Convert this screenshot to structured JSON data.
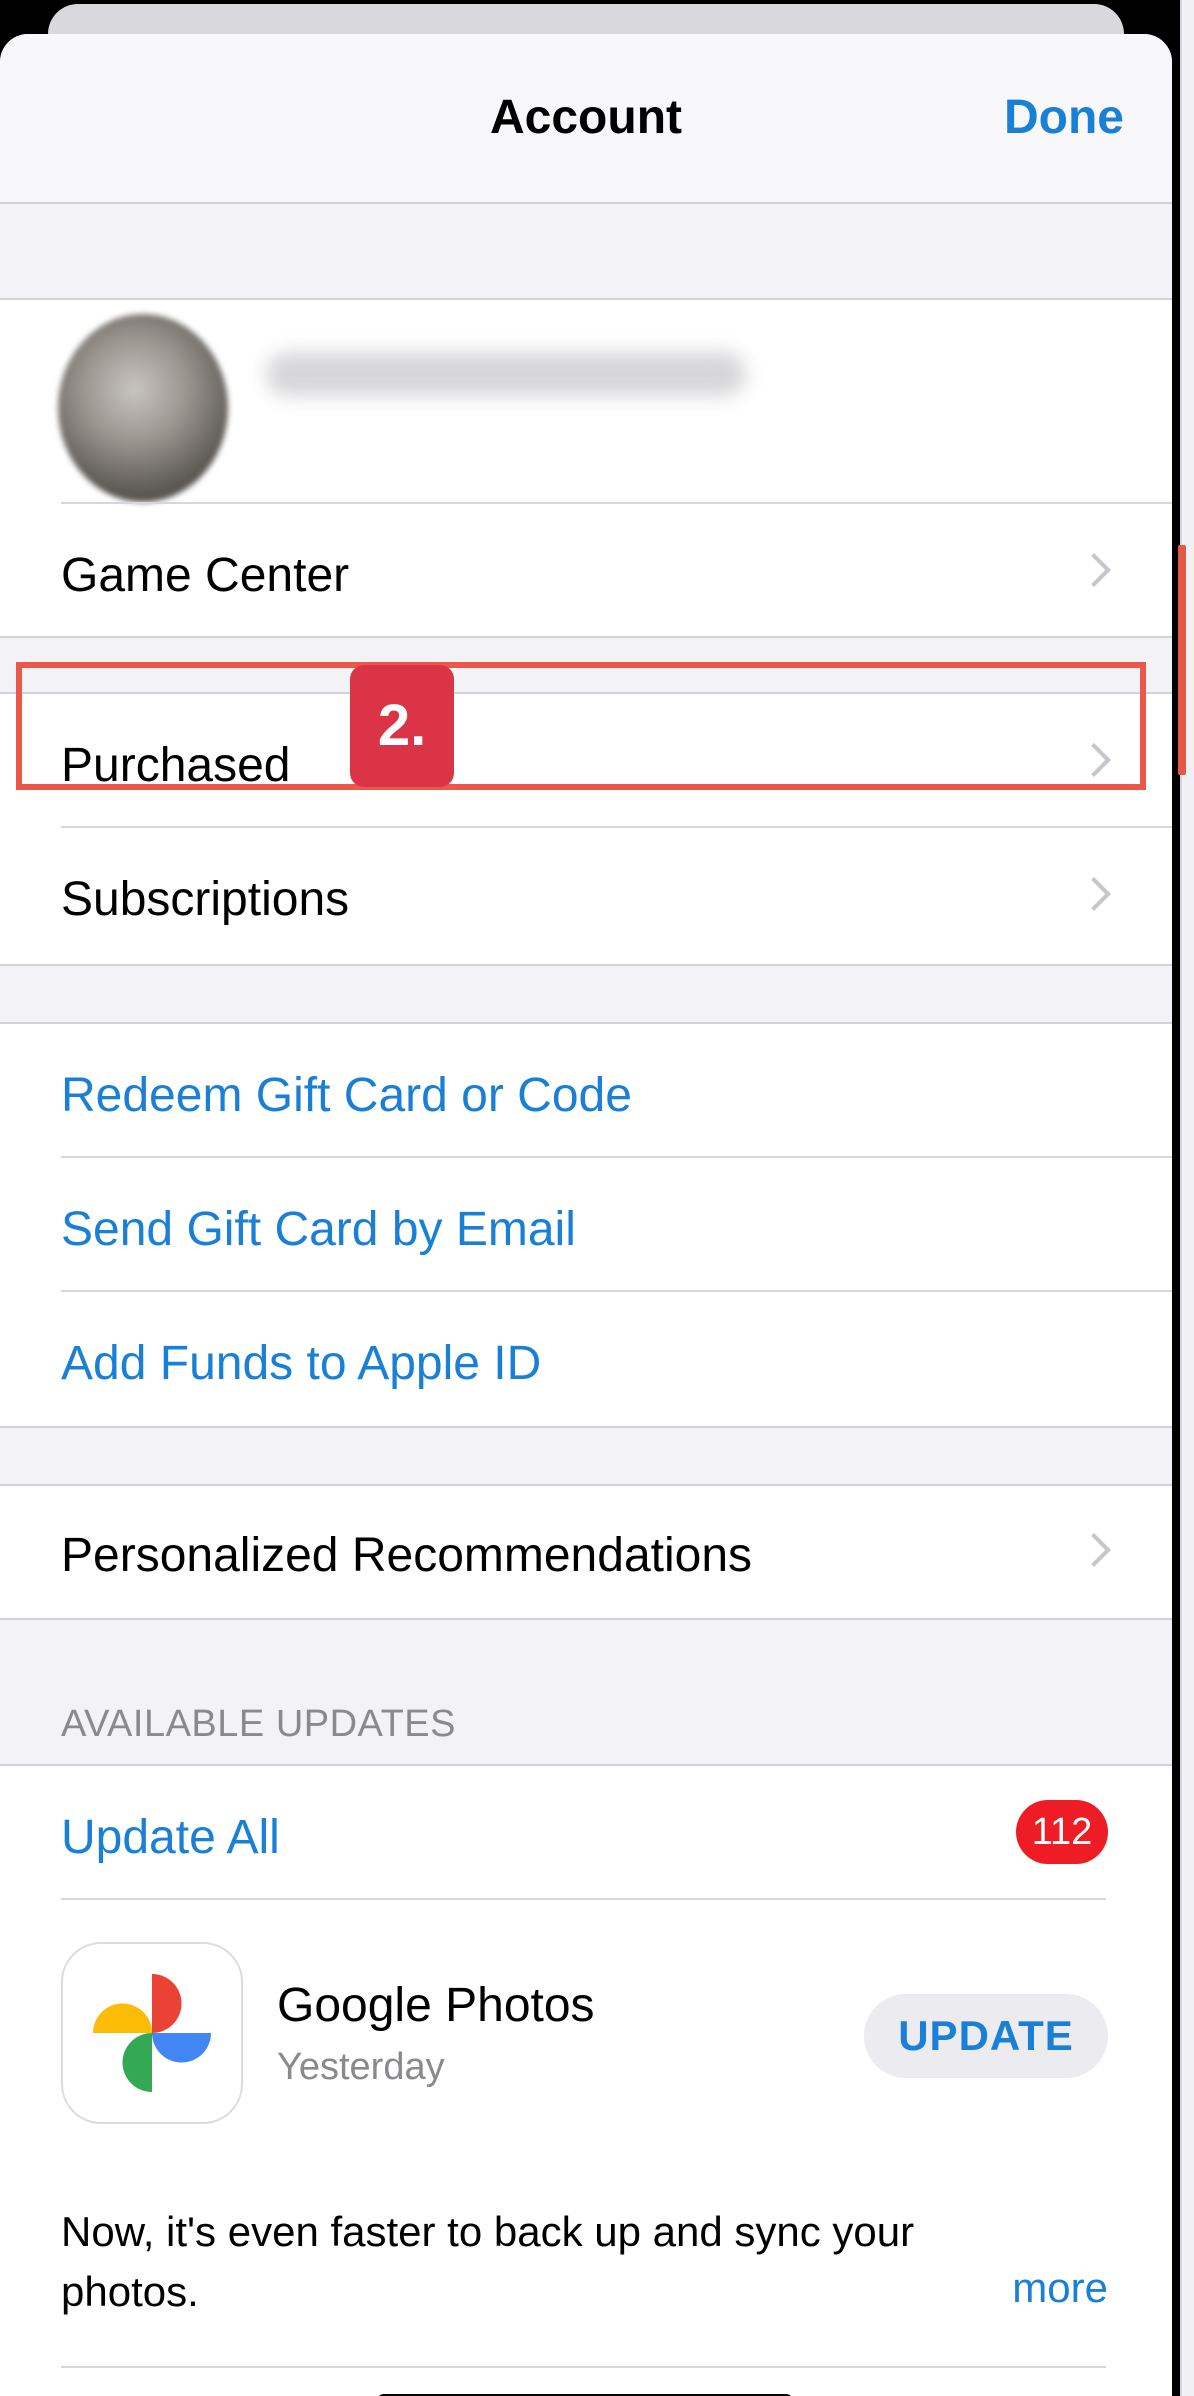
{
  "navbar": {
    "title": "Account",
    "done_label": "Done"
  },
  "profile": {
    "avatar": "user-avatar (blurred)"
  },
  "rows": {
    "game_center": "Game Center",
    "purchased": "Purchased",
    "subscriptions": "Subscriptions",
    "redeem": "Redeem Gift Card or Code",
    "send_gift": "Send Gift Card by Email",
    "add_funds": "Add Funds to Apple ID",
    "personalized": "Personalized Recommendations"
  },
  "annotation": {
    "step_label": "2.",
    "color": "#e9584a",
    "badge_color": "#dc3447"
  },
  "updates": {
    "section_header": "AVAILABLE UPDATES",
    "update_all": "Update All",
    "count": "112",
    "app": {
      "name": "Google Photos",
      "date": "Yesterday",
      "button": "UPDATE",
      "description": "Now, it's even faster to back up and sync your photos.",
      "more": "more",
      "icon": "google-photos-pinwheel-icon"
    }
  },
  "colors": {
    "accent": "#1a7fd6",
    "badge": "#ee1c24",
    "background": "#f2f2f7"
  }
}
